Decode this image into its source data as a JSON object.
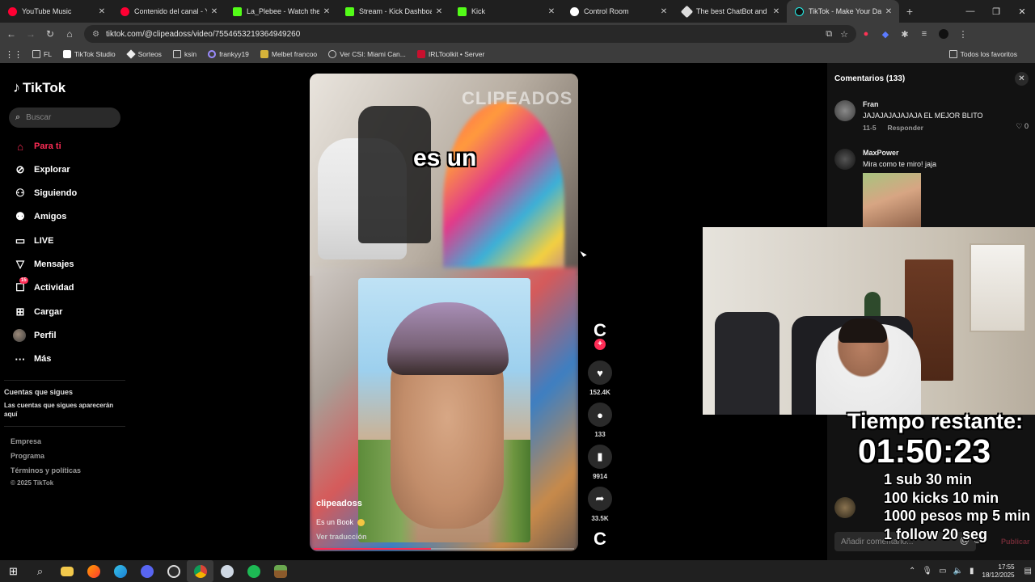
{
  "tabs": [
    {
      "title": "YouTube Music",
      "color": "#ff0033"
    },
    {
      "title": "Contenido del canal - YouTube Studio",
      "color": "#ff0033"
    },
    {
      "title": "La_Plebee - Watch the VOD",
      "color": "#53fc18"
    },
    {
      "title": "Stream - Kick Dashboard",
      "color": "#53fc18"
    },
    {
      "title": "Kick",
      "color": "#53fc18"
    },
    {
      "title": "Control Room",
      "color": "#ffffff"
    },
    {
      "title": "The best ChatBot and Widgets",
      "color": "#dddddd"
    },
    {
      "title": "TikTok - Make Your Day",
      "color": "#111111"
    }
  ],
  "address": {
    "url": "tiktok.com/@clipeadoss/video/7554653219364949260"
  },
  "bookmarks": [
    "FL",
    "TikTok Studio",
    "Sorteos",
    "ksin",
    "frankyy19",
    "Melbet francoo",
    "Ver CSI: Miami Can...",
    "IRLToolkit • Server"
  ],
  "bookmarks_right": "Todos los favoritos",
  "tiktok": {
    "logo": "TikTok",
    "search_placeholder": "Buscar",
    "nav": [
      "Para ti",
      "Explorar",
      "Siguiendo",
      "Amigos",
      "LIVE",
      "Mensajes",
      "Actividad",
      "Cargar",
      "Perfil",
      "Más"
    ],
    "activity_badge": "15",
    "following_title": "Cuentas que sigues",
    "following_text": "Las cuentas que sigues aparecerán aquí",
    "footer": [
      "Empresa",
      "Programa",
      "Términos y políticas",
      "© 2025 TikTok"
    ]
  },
  "video": {
    "caption": "es un",
    "watermark": "CLIPEADOS",
    "username": "clipeadoss",
    "description": "Es un Book",
    "translate": "Ver traducción",
    "progress": 0.45
  },
  "actions": {
    "likes": "152.4K",
    "comments": "133",
    "saves": "9914",
    "shares": "33.5K"
  },
  "comments": {
    "title": "Comentarios (133)",
    "items": [
      {
        "name": "Fran",
        "text": "JAJAJAJAJAJAJA EL MEJOR BLITO",
        "date": "11-5",
        "reply": "Responder",
        "likes": "0"
      },
      {
        "name": "MaxPower",
        "text": "Mira como te miro! jaja"
      }
    ],
    "input_placeholder": "Añadir comentario...",
    "post": "Publicar"
  },
  "overlay": {
    "timer_title": "Tiempo restante:",
    "timer_value": "01:50:23",
    "rules": [
      "1 sub 30 min",
      "100 kicks 10 min",
      "1000 pesos mp 5 min",
      "1 follow 20 seg"
    ]
  },
  "taskbar": {
    "time": "17:55",
    "date": "18/12/2025"
  }
}
